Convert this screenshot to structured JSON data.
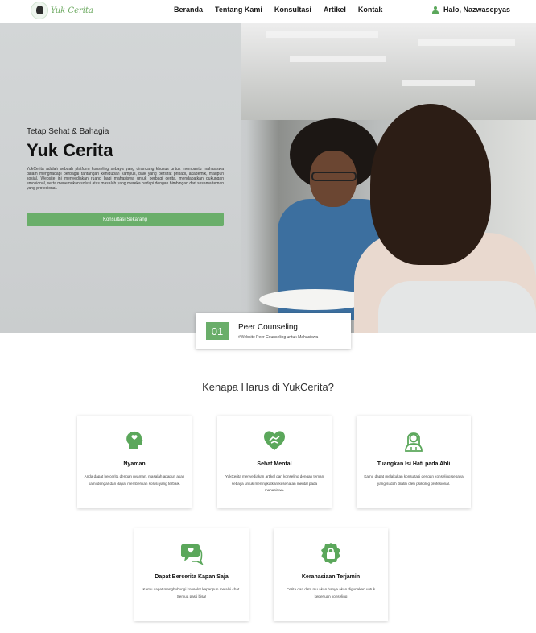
{
  "brand": {
    "name": "Yuk Cerita",
    "accent": "#6aae6a"
  },
  "nav": {
    "items": [
      "Beranda",
      "Tentang Kami",
      "Konsultasi",
      "Artikel",
      "Kontak"
    ],
    "user_greeting": "Halo, Nazwasepyas",
    "user_icon": "user-icon"
  },
  "hero": {
    "tagline": "Tetap Sehat & Bahagia",
    "title": "Yuk Cerita",
    "description": "YukCerita adalah sebuah platform konseling sebaya yang dirancang khusus untuk membantu mahasiswa dalam menghadapi berbagai tantangan kehidupan kampus, baik yang bersifat pribadi, akademik, maupun sosial. Website ini menyediakan ruang bagi mahasiswa untuk berbagi cerita, mendapatkan dukungan emosional, serta menemukan solusi atas masalah yang mereka hadapi dengan bimbingan dari sesama teman yang profesional.",
    "cta": "Konsultasi Sekarang"
  },
  "peer": {
    "number": "01",
    "title": "Peer Counseling",
    "subtitle": "#Website Peer Counseling untuk Mahasiswa"
  },
  "why": {
    "title": "Kenapa Harus di YukCerita?",
    "cards": [
      {
        "icon": "head-heart-icon",
        "title": "Nyaman",
        "text": "Anda dapat bercerita dengan nyaman, masalah apapun akan kami dengar dan dapat memberikan solusi yang terbaik."
      },
      {
        "icon": "heart-handshake-icon",
        "title": "Sehat Mental",
        "text": "YukCerita menyediakan artikel dan konseling dengan teman sebaya untuk meningkatkan kesehatan mental pada mahasiswa."
      },
      {
        "icon": "counselor-icon",
        "title": "Tuangkan Isi Hati pada Ahli",
        "text": "Kamu dapat melakukan konsultasi dengan konseling sebaya yang sudah dilatih oleh psikolog profesional."
      },
      {
        "icon": "chat-heart-icon",
        "title": "Dapat Bercerita Kapan Saja",
        "text": "Kamu dapat menghubungi konselor kapanpun melalui chat. Semua pasti bisa!"
      },
      {
        "icon": "lock-badge-icon",
        "title": "Kerahasiaan Terjamin",
        "text": "Cerita dan data mu akan hanya akan digunakan untuk keperluan konseling"
      }
    ]
  }
}
